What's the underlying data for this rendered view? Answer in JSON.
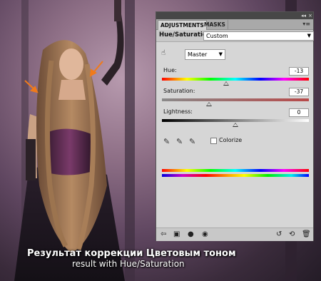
{
  "panel": {
    "tabs": [
      "ADJUSTMENTS",
      "MASKS"
    ],
    "title": "Hue/Saturation",
    "preset": "Custom",
    "channel": "Master",
    "sliders": [
      {
        "label": "Hue:",
        "value": "-13"
      },
      {
        "label": "Saturation:",
        "value": "-37"
      },
      {
        "label": "Lightness:",
        "value": "0"
      }
    ],
    "colorize_label": "Colorize",
    "colorize_checked": false
  },
  "caption": {
    "line1": "Результат коррекции Цветовым тоном",
    "line2": "result with Hue/Saturation"
  },
  "colors": {
    "panel_bg": "#d6d6d6",
    "arrow": "#f07a1a"
  }
}
